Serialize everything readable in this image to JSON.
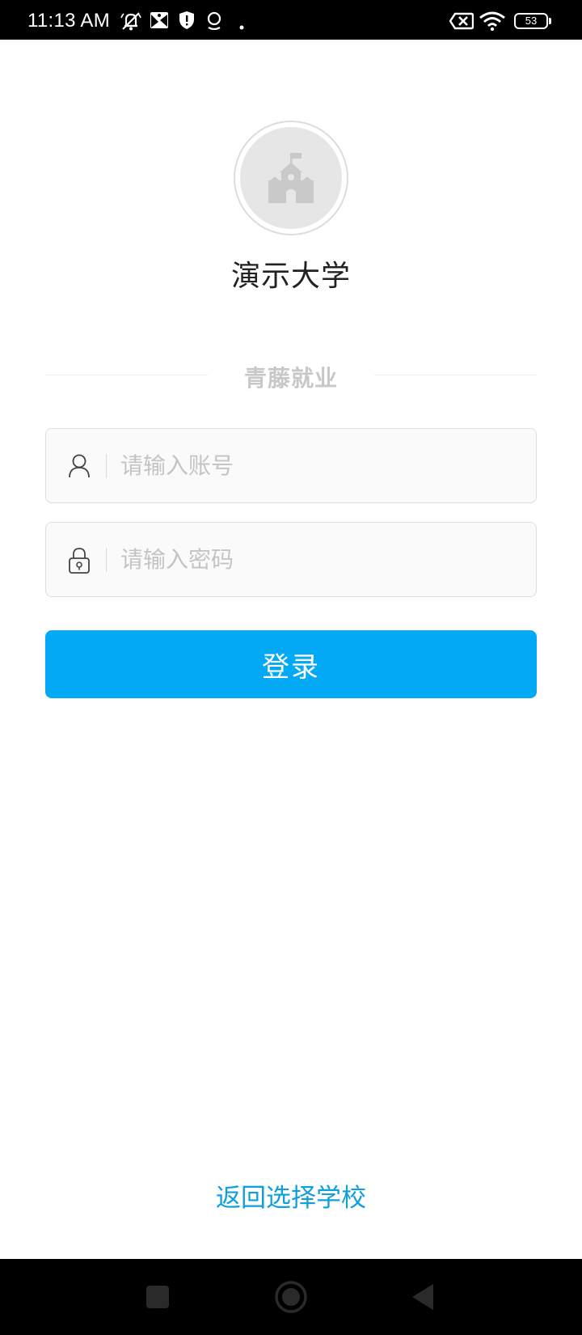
{
  "status_bar": {
    "time": "11:13 AM",
    "battery_level": "53",
    "icons": [
      "muted-notification-icon",
      "screenshot-icon",
      "shield-icon",
      "location-icon",
      "dot-icon",
      "no-sim-icon",
      "wifi-icon",
      "battery-icon"
    ]
  },
  "school": {
    "logo_icon": "school-building-icon",
    "name": "演示大学"
  },
  "brand": {
    "name": "青藤就业"
  },
  "login_form": {
    "account_placeholder": "请输入账号",
    "account_value": "",
    "password_placeholder": "请输入密码",
    "password_value": "",
    "login_label": "登录"
  },
  "footer": {
    "back_label": "返回选择学校"
  },
  "nav_bar": {
    "buttons": [
      "recent-apps-icon",
      "home-icon",
      "back-icon"
    ]
  },
  "colors": {
    "accent": "#03a9f4",
    "link": "#0e9fdc",
    "brand_text": "#c8c8c8",
    "status_bar_bg": "#000000"
  }
}
